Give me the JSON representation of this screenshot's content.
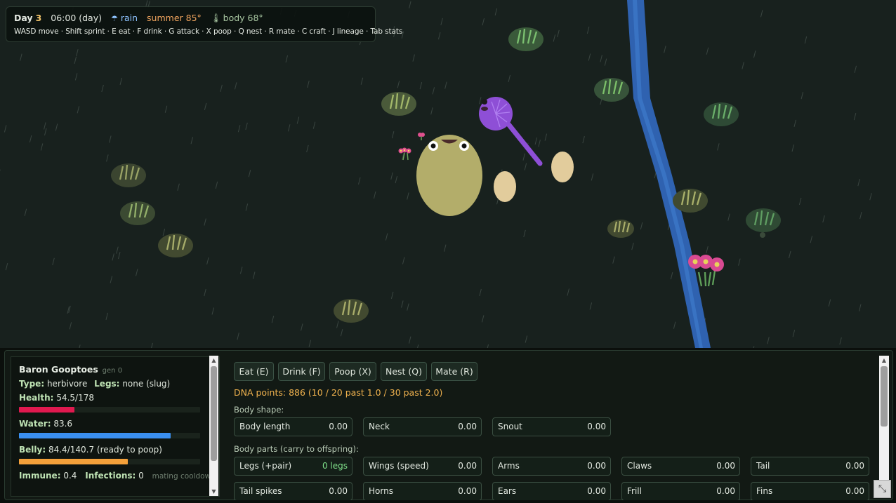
{
  "hud": {
    "day_prefix": "Day",
    "day_number": "3",
    "time": "06:00 (day)",
    "weather_icon": "umbrella-icon",
    "weather": "rain",
    "season": "summer 85°",
    "thermometer_icon": "thermometer-icon",
    "body_temp": "body 68°",
    "controls": "WASD move · Shift sprint · E eat · F drink · G attack · X poop · Q nest · R mate · C craft · J lineage · Tab stats"
  },
  "stats": {
    "name": "Baron Gooptoes",
    "gen": "gen 0",
    "type_label": "Type:",
    "type_value": "herbivore",
    "legs_label": "Legs:",
    "legs_value": "none (slug)",
    "health_label": "Health:",
    "health_value": "54.5/178",
    "health_fraction": 0.306,
    "water_label": "Water:",
    "water_value": "83.6",
    "water_fraction": 0.836,
    "belly_label": "Belly:",
    "belly_value": "84.4/140.7 (ready to poop)",
    "belly_fraction": 0.6,
    "immune_label": "Immune:",
    "immune_value": "0.4",
    "infections_label": "Infections:",
    "infections_value": "0",
    "status_note": "mating cooldown"
  },
  "actions": [
    {
      "label": "Eat (E)"
    },
    {
      "label": "Drink (F)"
    },
    {
      "label": "Poop (X)"
    },
    {
      "label": "Nest (Q)"
    },
    {
      "label": "Mate (R)"
    }
  ],
  "dna": "DNA points: 886 (10 / 20 past 1.0 / 30 past 2.0)",
  "body_shape_label": "Body shape:",
  "body_shape": [
    {
      "name": "Body length",
      "value": "0.00"
    },
    {
      "name": "Neck",
      "value": "0.00"
    },
    {
      "name": "Snout",
      "value": "0.00"
    }
  ],
  "body_parts_label": "Body parts (carry to offspring):",
  "body_parts": [
    {
      "name": "Legs (+pair)",
      "value": "0 legs"
    },
    {
      "name": "Wings (speed)",
      "value": "0.00"
    },
    {
      "name": "Arms",
      "value": "0.00"
    },
    {
      "name": "Claws",
      "value": "0.00"
    },
    {
      "name": "Tail",
      "value": "0.00"
    },
    {
      "name": "Tail spikes",
      "value": "0.00"
    },
    {
      "name": "Horns",
      "value": "0.00"
    },
    {
      "name": "Ears",
      "value": "0.00"
    },
    {
      "name": "Frill",
      "value": "0.00"
    },
    {
      "name": "Fins",
      "value": "0.00"
    }
  ],
  "colors": {
    "health": "#e0194f",
    "water": "#3a8ff0",
    "belly": "#f5a13a",
    "river": "#2f62b0",
    "player": "#b3ad6a",
    "rival": "#8e4fd6"
  }
}
